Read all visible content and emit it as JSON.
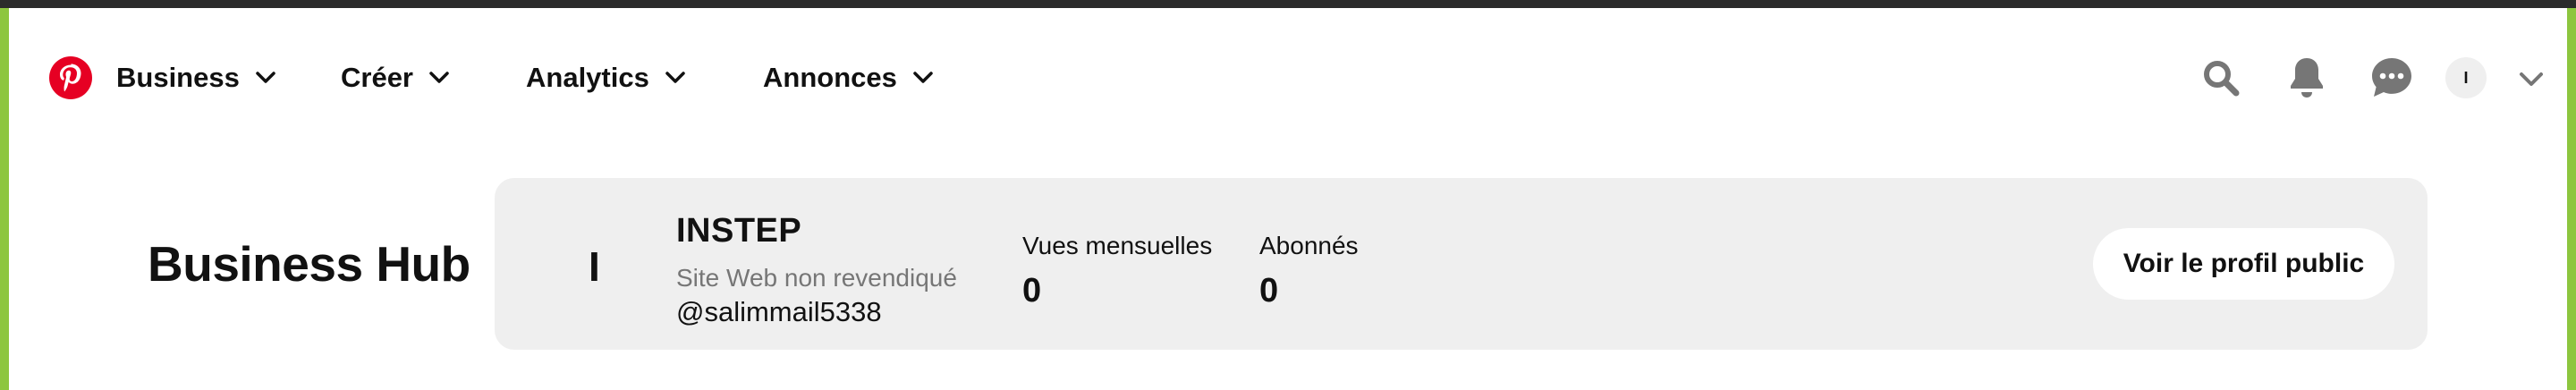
{
  "nav": {
    "logo_icon": "pinterest-logo-icon",
    "items": [
      {
        "label": "Business"
      },
      {
        "label": "Créer"
      },
      {
        "label": "Analytics"
      },
      {
        "label": "Annonces"
      }
    ],
    "right_icons": [
      "search-icon",
      "bell-icon",
      "messages-icon"
    ],
    "account_initial": "I"
  },
  "hub": {
    "title": "Business Hub",
    "profile": {
      "avatar_initial": "I",
      "name": "INSTEP",
      "website_status": "Site Web non revendiqué",
      "handle": "@salimmail5338"
    },
    "stats": [
      {
        "label": "Vues mensuelles",
        "value": "0"
      },
      {
        "label": "Abonnés",
        "value": "0"
      }
    ],
    "public_profile_button": "Voir le profil public"
  },
  "colors": {
    "brand_red": "#e60023",
    "frame_green": "#8dc63f",
    "card_bg": "#efefef",
    "icon_gray": "#767676"
  }
}
